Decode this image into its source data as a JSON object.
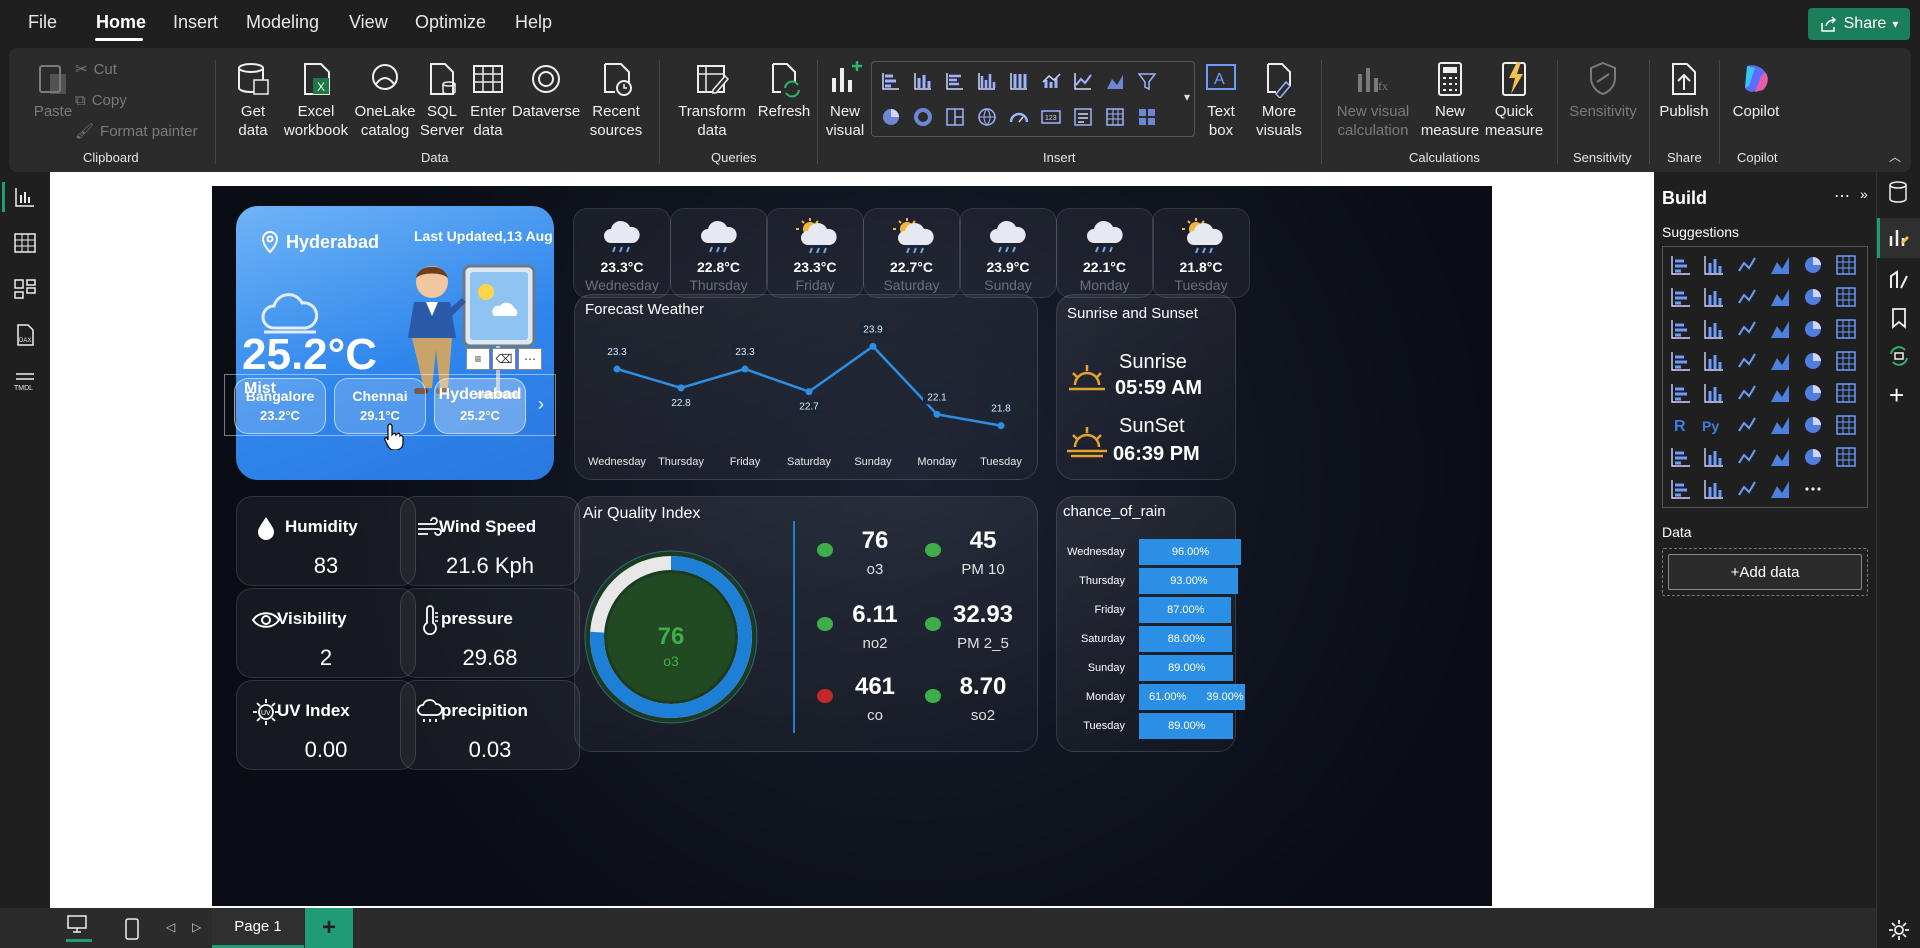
{
  "menu": {
    "items": [
      "File",
      "Home",
      "Insert",
      "Modeling",
      "View",
      "Optimize",
      "Help"
    ],
    "active": "Home",
    "share_label": "Share"
  },
  "ribbon": {
    "clipboard": {
      "paste": "Paste",
      "cut": "Cut",
      "copy": "Copy",
      "format_painter": "Format painter",
      "group": "Clipboard"
    },
    "data": {
      "get_data": "Get data",
      "excel": "Excel workbook",
      "onelake": "OneLake catalog",
      "sql": "SQL Server",
      "enter": "Enter data",
      "dataverse": "Dataverse",
      "recent": "Recent sources",
      "group": "Data"
    },
    "queries": {
      "transform": "Transform data",
      "refresh": "Refresh",
      "group": "Queries"
    },
    "insert": {
      "new_visual": "New visual",
      "text_box": "Text box",
      "more_visuals": "More visuals",
      "group": "Insert"
    },
    "calculations": {
      "new_visual_calc": "New visual calculation",
      "new_measure": "New measure",
      "quick_measure": "Quick measure",
      "group": "Calculations"
    },
    "sensitivity": {
      "label": "Sensitivity",
      "group": "Sensitivity"
    },
    "share": {
      "publish": "Publish",
      "group": "Share"
    },
    "copilot": {
      "label": "Copilot",
      "group": "Copilot"
    }
  },
  "report": {
    "current": {
      "city": "Hyderabad",
      "updated": "Last Updated,13 Aug",
      "temp": "25.2°C",
      "condition": "Mist"
    },
    "cities": [
      {
        "name": "Bangalore",
        "temp": "23.2°C"
      },
      {
        "name": "Chennai",
        "temp": "29.1°C"
      },
      {
        "name": "Hyderabad",
        "temp": "25.2°C"
      }
    ],
    "forecast_cards": [
      {
        "temp": "23.3°C",
        "day": "Wednesday",
        "icon": "rain-cloud-icon"
      },
      {
        "temp": "22.8°C",
        "day": "Thursday",
        "icon": "rain-cloud-icon"
      },
      {
        "temp": "23.3°C",
        "day": "Friday",
        "icon": "sun-rain-cloud-icon"
      },
      {
        "temp": "22.7°C",
        "day": "Saturday",
        "icon": "sun-rain-cloud-icon"
      },
      {
        "temp": "23.9°C",
        "day": "Sunday",
        "icon": "rain-cloud-icon"
      },
      {
        "temp": "22.1°C",
        "day": "Monday",
        "icon": "rain-cloud-icon"
      },
      {
        "temp": "21.8°C",
        "day": "Tuesday",
        "icon": "sun-rain-cloud-icon"
      }
    ],
    "stats": {
      "humidity": {
        "label": "Humidity",
        "value": "83"
      },
      "wind": {
        "label": "Wind Speed",
        "value": "21.6 Kph"
      },
      "visibility": {
        "label": "Visibility",
        "value": "2"
      },
      "pressure": {
        "label": "pressure",
        "value": "29.68"
      },
      "uv": {
        "label": "UV Index",
        "value": "0.00"
      },
      "precip": {
        "label": "precipition",
        "value": "0.03"
      }
    },
    "sun": {
      "title": "Sunrise and Sunset",
      "sunrise_label": "Sunrise",
      "sunrise": "05:59 AM",
      "sunset_label": "SunSet",
      "sunset": "06:39 PM"
    },
    "aqi": {
      "title": "Air Quality Index",
      "gauge_value": "76",
      "gauge_label": "o3",
      "gauge_fraction": 0.76,
      "items": [
        {
          "value": "76",
          "name": "o3",
          "color": "#3fae49"
        },
        {
          "value": "45",
          "name": "PM 10",
          "color": "#3fae49"
        },
        {
          "value": "6.11",
          "name": "no2",
          "color": "#3fae49"
        },
        {
          "value": "32.93",
          "name": "PM 2_5",
          "color": "#3fae49"
        },
        {
          "value": "461",
          "name": "co",
          "color": "#c62828"
        },
        {
          "value": "8.70",
          "name": "so2",
          "color": "#3fae49"
        }
      ]
    },
    "rain_title": "chance_of_rain"
  },
  "chart_data": [
    {
      "type": "line",
      "title": "Forecast Weather",
      "categories": [
        "Wednesday",
        "Thursday",
        "Friday",
        "Saturday",
        "Sunday",
        "Monday",
        "Tuesday"
      ],
      "values": [
        23.3,
        22.8,
        23.3,
        22.7,
        23.9,
        22.1,
        21.8
      ],
      "labels": [
        "23.3",
        "22.8",
        "23.3",
        "22.7",
        "23.9",
        "22.1",
        "21.8"
      ],
      "ylim": [
        21.5,
        24.2
      ],
      "color": "#2b8fe6",
      "grid": false
    },
    {
      "type": "bar",
      "title": "chance_of_rain",
      "categories": [
        "Wednesday",
        "Thursday",
        "Friday",
        "Saturday",
        "Sunday",
        "Monday",
        "Tuesday"
      ],
      "series": [
        {
          "values": [
            96,
            93,
            87,
            88,
            89,
            61,
            89
          ],
          "labels": [
            "96.00%",
            "93.00%",
            "87.00%",
            "88.00%",
            "89.00%",
            "61.00%",
            "89.00%"
          ]
        },
        {
          "values": [
            0,
            0,
            0,
            0,
            0,
            39,
            0
          ],
          "labels": [
            "",
            "",
            "",
            "",
            "",
            "39.00%",
            ""
          ]
        }
      ],
      "orientation": "horizontal",
      "stacked": true,
      "color": "#2b8fe6"
    }
  ],
  "build": {
    "title": "Build",
    "suggestions": "Suggestions",
    "data": "Data",
    "add_data": "+Add data"
  },
  "bottom": {
    "page": "Page 1",
    "add": "+"
  }
}
